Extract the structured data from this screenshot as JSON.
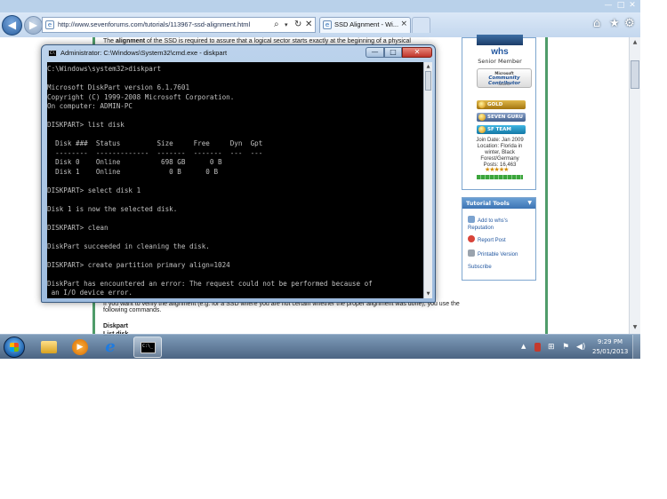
{
  "browser": {
    "url": "http://www.sevenforums.com/tutorials/113967-ssd-alignment.html",
    "tab_title": "SSD Alignment - Wi...",
    "tab_close": "×",
    "back_glyph": "◀",
    "forward_glyph": "▶",
    "window_controls": {
      "minimize": "—",
      "maximize": "□",
      "close": "✕"
    },
    "toolbar_icons": [
      "home-icon",
      "favorites-icon",
      "tools-icon"
    ],
    "address_icons": [
      "search-icon",
      "dropdown-icon",
      "refresh-icon",
      "stop-icon"
    ]
  },
  "article": {
    "intro_bold": "alignment",
    "intro_prefix": "The ",
    "intro_suffix": " of the SSD is required to assure that a logical sector starts exactly at the beginning of a physical",
    "verify_text": "If you want to verify the alignment (e.g. for a SSD where you are not certain whether the proper alignment was done), you use the",
    "verify_text2": "following commands.",
    "diskpart_heading": "Diskpart",
    "diskpart_heading2": "List disk"
  },
  "profile": {
    "username": "whs",
    "rank": "Senior Member",
    "mvp_title": "Microsoft",
    "mvp_line": "Community Contributor",
    "mvp_award": "AWARD",
    "badges": [
      "GOLD MEMBER",
      "SEVEN GURU",
      "SF TEAM"
    ],
    "join_date": "Join Date: Jan 2009",
    "location_1": "Location: Florida in",
    "location_2": "winter, Black",
    "location_3": "Forest/Germany",
    "posts": "Posts: 16,463",
    "stars": "★★★★★"
  },
  "tutorial_tools": {
    "header": "Tutorial Tools",
    "items": [
      "Add to whs's Reputation",
      "Report Post",
      "Printable Version",
      "Subscribe"
    ]
  },
  "cmd": {
    "title": "Administrator: C:\\Windows\\System32\\cmd.exe - diskpart",
    "icon_text": "C:\\",
    "controls": {
      "minimize": "—",
      "maximize": "□",
      "close": "✕"
    },
    "output": "C:\\Windows\\system32>diskpart\n\nMicrosoft DiskPart version 6.1.7601\nCopyright (C) 1999-2008 Microsoft Corporation.\nOn computer: ADMIN-PC\n\nDISKPART> list disk\n\n  Disk ###  Status         Size     Free     Dyn  Gpt\n  --------  -------------  -------  -------  ---  ---\n  Disk 0    Online          698 GB      0 B\n  Disk 1    Online            0 B      0 B\n\nDISKPART> select disk 1\n\nDisk 1 is now the selected disk.\n\nDISKPART> clean\n\nDiskPart succeeded in cleaning the disk.\n\nDISKPART> create partition primary align=1024\n\nDiskPart has encountered an error: The request could not be performed because of\n an I/O device error."
  },
  "taskbar": {
    "apps": [
      "start-button",
      "explorer",
      "media-player",
      "internet-explorer",
      "cmd"
    ],
    "tray_icons": [
      "show-hidden-arrow-icon",
      "security-icon",
      "network-icon",
      "action-center-icon",
      "speaker-icon"
    ],
    "time": "9:29 PM",
    "date": "25/01/2013"
  }
}
